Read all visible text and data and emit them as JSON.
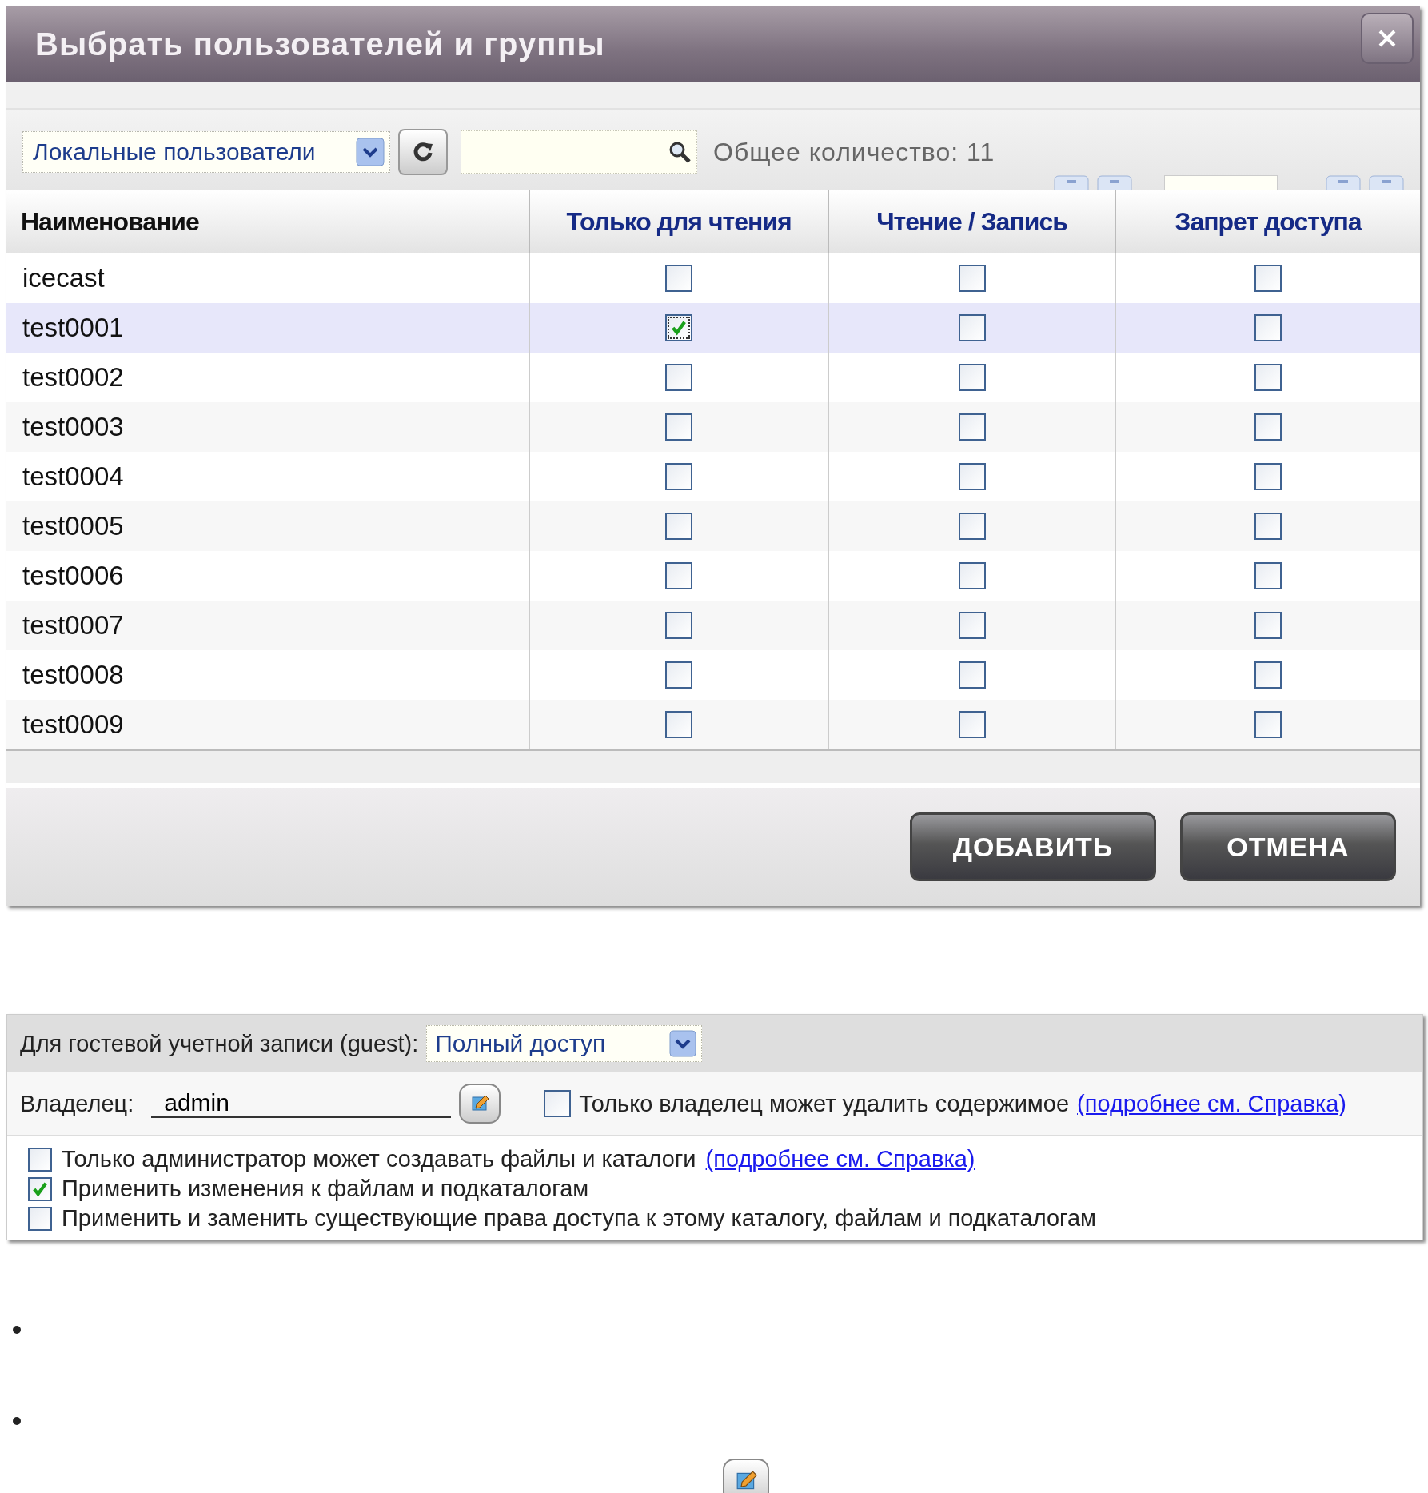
{
  "dialog": {
    "title": "Выбрать пользователей и группы",
    "toolbar": {
      "source": "Локальные пользователи",
      "total": "Общее количество:  11"
    },
    "table": {
      "columns": [
        "Наименование",
        "Только для чтения",
        "Чтение / Запись",
        "Запрет доступа"
      ],
      "rows": [
        {
          "name": "icecast",
          "selected": false,
          "read_only": false,
          "read_write": false,
          "deny": false
        },
        {
          "name": "test0001",
          "selected": true,
          "read_only": true,
          "read_write": false,
          "deny": false
        },
        {
          "name": "test0002",
          "selected": false,
          "read_only": false,
          "read_write": false,
          "deny": false
        },
        {
          "name": "test0003",
          "selected": false,
          "read_only": false,
          "read_write": false,
          "deny": false
        },
        {
          "name": "test0004",
          "selected": false,
          "read_only": false,
          "read_write": false,
          "deny": false
        },
        {
          "name": "test0005",
          "selected": false,
          "read_only": false,
          "read_write": false,
          "deny": false
        },
        {
          "name": "test0006",
          "selected": false,
          "read_only": false,
          "read_write": false,
          "deny": false
        },
        {
          "name": "test0007",
          "selected": false,
          "read_only": false,
          "read_write": false,
          "deny": false
        },
        {
          "name": "test0008",
          "selected": false,
          "read_only": false,
          "read_write": false,
          "deny": false
        },
        {
          "name": "test0009",
          "selected": false,
          "read_only": false,
          "read_write": false,
          "deny": false
        }
      ]
    },
    "buttons": [
      "ДОБАВИТЬ",
      "ОТМЕНА"
    ]
  },
  "permissions": {
    "guest_label": "Для гостевой учетной записи (guest):",
    "guest_access": "Полный доступ",
    "owner_label": "Владелец:",
    "owner": "admin",
    "owner_only_delete": {
      "label": "Только владелец может удалить содержимое",
      "checked": false,
      "link": "(подробнее см. Справка)"
    },
    "options": [
      {
        "label": "Только администратор может создавать файлы и каталоги",
        "checked": false,
        "link": "(подробнее см. Справка)"
      },
      {
        "label": "Применить изменения к файлам и подкаталогам",
        "checked": true
      },
      {
        "label": "Применить и заменить существующие права доступа к этому каталогу, файлам и подкаталогам",
        "checked": false
      }
    ]
  },
  "bullets": [
    {
      "kind": "empty"
    },
    {
      "kind": "empty"
    }
  ]
}
